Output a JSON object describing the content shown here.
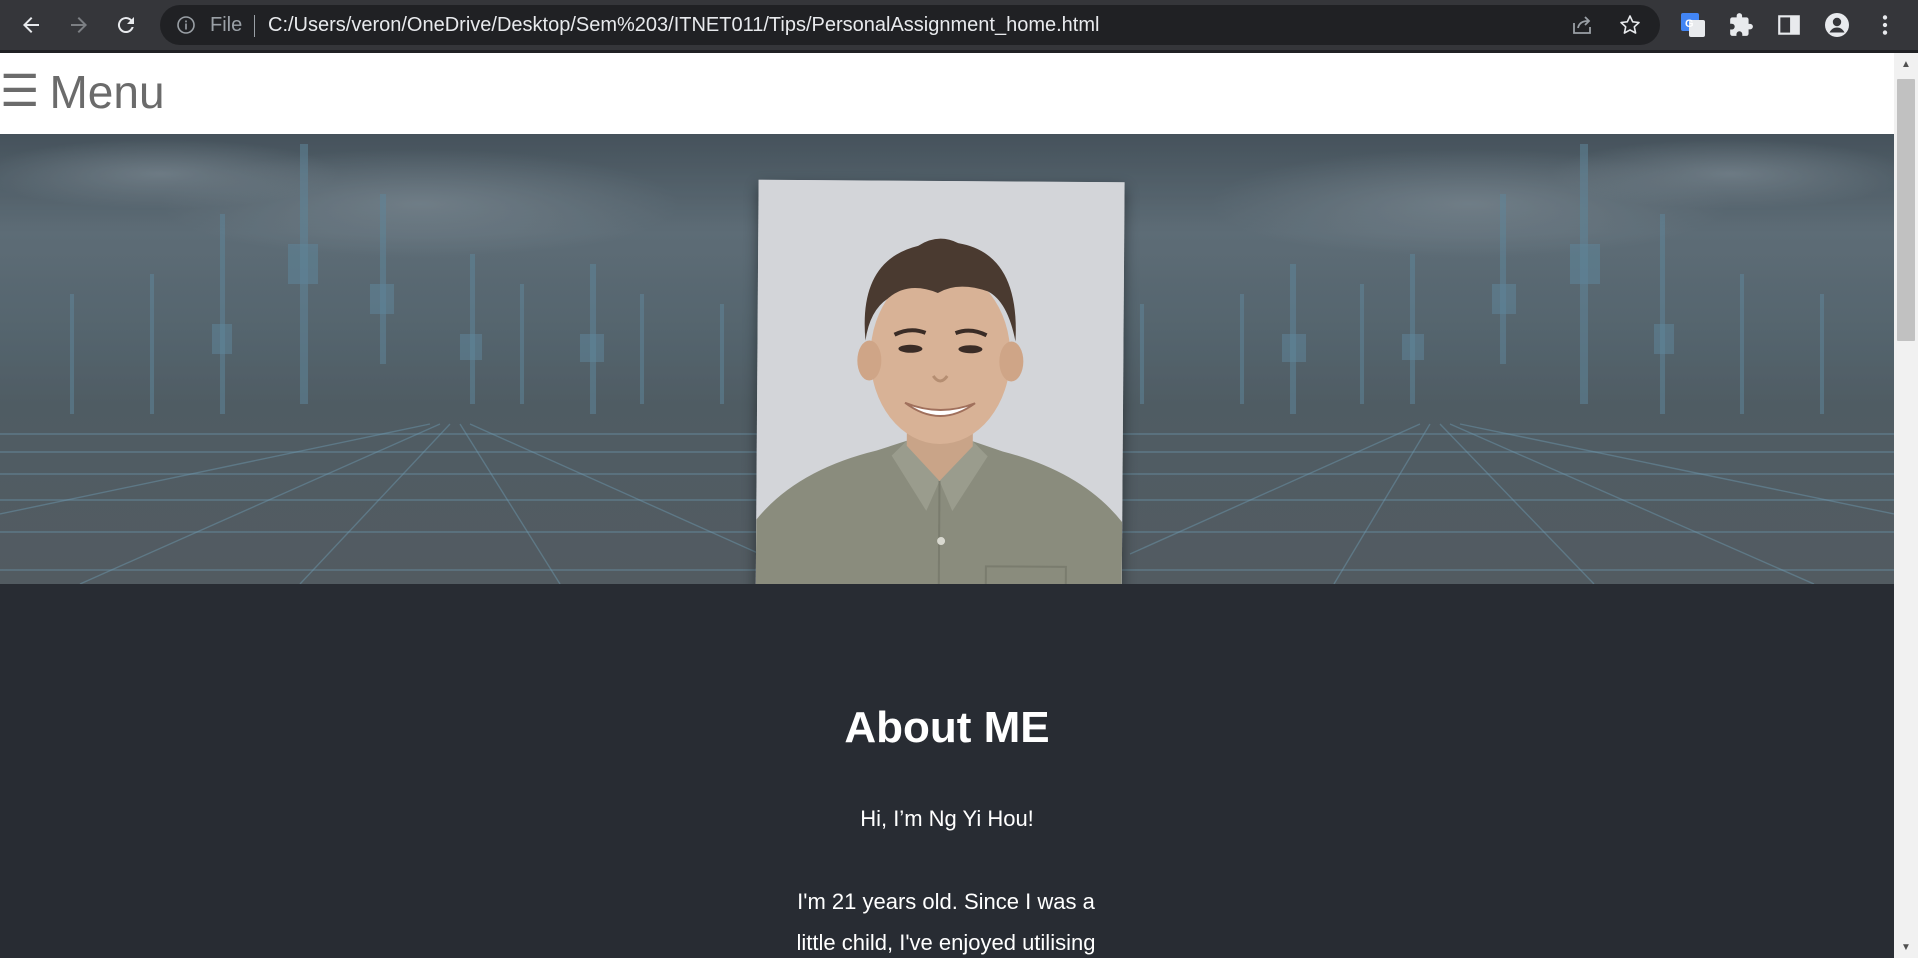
{
  "browser": {
    "back_icon": "arrow-left-icon",
    "forward_icon": "arrow-right-icon",
    "reload_icon": "reload-icon",
    "scheme_label": "File",
    "url": "C:/Users/veron/OneDrive/Desktop/Sem%203/ITNET011/Tips/PersonalAssignment_home.html",
    "toolbar_icons": [
      "share-icon",
      "star-icon",
      "google-translate-icon",
      "extensions-icon",
      "side-panel-icon",
      "profile-icon",
      "more-icon"
    ],
    "colors": {
      "chrome": "#35363a",
      "omnibox": "#202124",
      "url_text": "#e8eaed",
      "dim_text": "#9aa0a6"
    }
  },
  "page": {
    "menu": {
      "icon": "☰",
      "label": "Menu"
    },
    "hero": {
      "portrait_alt": "portrait photo"
    },
    "about": {
      "title": "About ME",
      "greeting": "Hi, I’m Ng Yi Hou!",
      "body": "I'm 21 years old. Since I was a little child, I've enjoyed utilising"
    },
    "colors": {
      "menu_bg": "#ffffff",
      "menu_text": "#6b6b6b",
      "section_bg": "#282c33",
      "section_text": "#ffffff"
    }
  }
}
